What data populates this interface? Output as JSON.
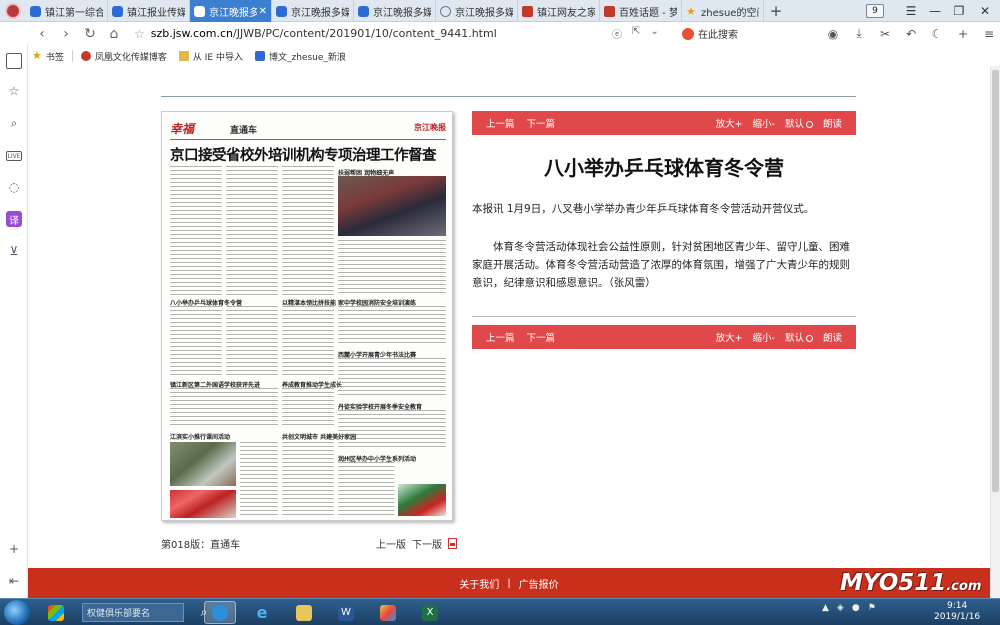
{
  "browser": {
    "tabs": [
      {
        "label": "镇江第一综合台",
        "icon": "paw-icon",
        "active": false,
        "closable": false
      },
      {
        "label": "镇江报业传媒集",
        "icon": "paw-icon",
        "active": false,
        "closable": false
      },
      {
        "label": "京江晚报多媒",
        "icon": "paw-icon",
        "active": true,
        "closable": true
      },
      {
        "label": "京江晚报多媒",
        "icon": "paw-icon",
        "active": false,
        "closable": false
      },
      {
        "label": "京江晚报多媒",
        "icon": "paw-icon",
        "active": false,
        "closable": false
      },
      {
        "label": "京江晚报多媒",
        "icon": "globe-icon",
        "active": false,
        "closable": false
      },
      {
        "label": "镇江网友之家",
        "icon": "site-icon",
        "active": false,
        "closable": false
      },
      {
        "label": "百姓话题 - 梦",
        "icon": "site-icon",
        "active": false,
        "closable": false
      },
      {
        "label": "zhesue的空间",
        "icon": "star-icon",
        "active": false,
        "closable": false
      }
    ],
    "tab_counter": "9",
    "url_host": "szb.jsw.com.cn",
    "url_path": "/JJWB/PC/content/201901/10/content_9441.html",
    "search_label": "在此搜索",
    "bookmarks": [
      {
        "label": "书签",
        "icon": "star-icon"
      },
      {
        "label": "凤凰文化传媒博客",
        "icon": "site-icon"
      },
      {
        "label": "从 IE 中导入",
        "icon": "folder-icon"
      },
      {
        "label": "博文_zhesue_新浪",
        "icon": "paw-icon"
      }
    ]
  },
  "newspaper": {
    "brand": "幸福",
    "section": "直通车",
    "masthead": "京江晚报",
    "headline": "京口接受省校外培训机构专项治理工作督查",
    "subheads": [
      "扶弱帮困 润物细无声",
      "镇江新区第二外国语学校获评先进",
      "江滨实小推行课间活动",
      "八小举办乒乓球体育冬令营",
      "家中学校园消防安全培训演练",
      "西麓小学开展青少年书法比赛",
      "丹徒实验学校开展冬季安全教育",
      "润州区举办中小学生系列活动",
      "以精湛本领比拼技能",
      "养成教育推动学生成长",
      "共创文明城市 共建美好家园"
    ],
    "page_label": "第018版：直通车",
    "prev_page": "上一版",
    "next_page": "下一版"
  },
  "article": {
    "nav_prev": "上一篇",
    "nav_next": "下一篇",
    "zoom_in": "放大+",
    "zoom_out": "缩小-",
    "default": "默认",
    "read_aloud": "朗读",
    "title": "八小举办乒乓球体育冬令营",
    "paragraph1": "本报讯 1月9日，八叉巷小学举办青少年乒乓球体育冬令营活动开营仪式。",
    "paragraph2": "　　体育冬令营活动体现社会公益性原则，针对贫困地区青少年、留守儿童、困难家庭开展活动。体育冬令营活动营造了浓厚的体育氛围，增强了广大青少年的规则意识，纪律意识和感恩意识。（张风雷）"
  },
  "footer": {
    "about": "关于我们",
    "divider": "|",
    "ads": "广告报价",
    "watermark": "MYO511",
    "watermark_tld": ".com"
  },
  "taskbar": {
    "search_placeholder": "权健俱乐部要名",
    "time": "9:14",
    "date": "2019/1/16"
  }
}
